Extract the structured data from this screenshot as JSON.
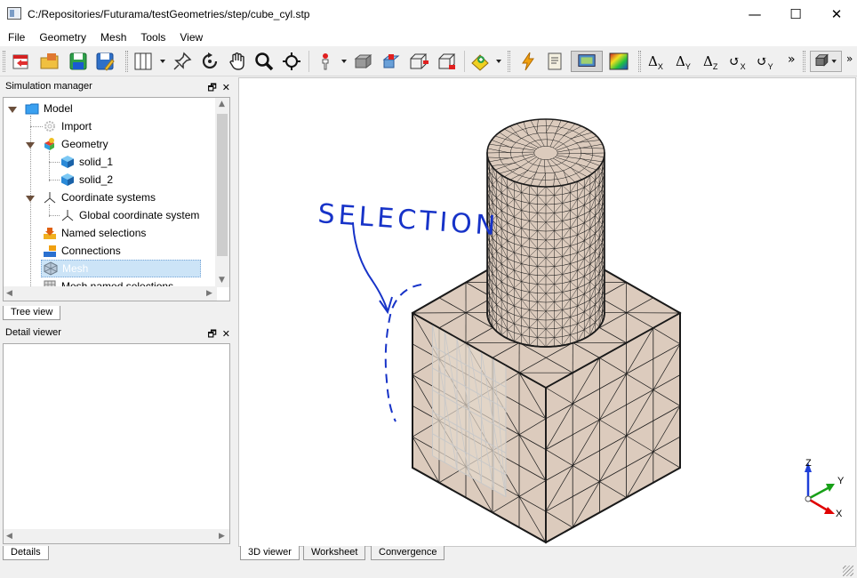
{
  "window": {
    "title": "C:/Repositories/Futurama/testGeometries/step/cube_cyl.stp",
    "minimize_glyph": "—",
    "maximize_glyph": "☐",
    "close_glyph": "✕"
  },
  "menu": [
    "File",
    "Geometry",
    "Mesh",
    "Tools",
    "View"
  ],
  "toolbar": {
    "overflow_glyph": "»",
    "transform_buttons": [
      {
        "symbol": "Δ",
        "axis": "X"
      },
      {
        "symbol": "Δ",
        "axis": "Y"
      },
      {
        "symbol": "Δ",
        "axis": "Z"
      },
      {
        "symbol": "↺",
        "axis": "X"
      },
      {
        "symbol": "↺",
        "axis": "Y"
      }
    ]
  },
  "simulation_manager": {
    "title": "Simulation manager",
    "float_glyph": "🗗",
    "close_glyph": "✕",
    "tree": [
      {
        "label": "Model",
        "icon": "folder-icon"
      },
      {
        "label": "Import",
        "icon": "gear-icon"
      },
      {
        "label": "Geometry",
        "icon": "geometry-icon"
      },
      {
        "label": "solid_1",
        "icon": "cube-icon"
      },
      {
        "label": "solid_2",
        "icon": "cube-icon"
      },
      {
        "label": "Coordinate systems",
        "icon": "axes-icon"
      },
      {
        "label": "Global coordinate system",
        "icon": "axes-icon"
      },
      {
        "label": "Named selections",
        "icon": "named-selection-icon"
      },
      {
        "label": "Connections",
        "icon": "connections-icon"
      },
      {
        "label": "Mesh",
        "icon": "mesh-icon",
        "selected": true
      },
      {
        "label": "Mesh named selections",
        "icon": "mesh-named-selection-icon"
      }
    ],
    "tab": "Tree view"
  },
  "detail_viewer": {
    "title": "Detail viewer",
    "float_glyph": "🗗",
    "close_glyph": "✕",
    "tab": "Details"
  },
  "viewer_tabs": [
    "3D viewer",
    "Worksheet",
    "Convergence"
  ],
  "viewport": {
    "annotation": "SELECTION",
    "axis_labels": {
      "x": "X",
      "y": "Y",
      "z": "Z"
    }
  },
  "colors": {
    "mesh_fill": "#dccbbd",
    "mesh_line": "#1a1a1a",
    "selection_mesh": "#c8c8c8",
    "annotation_ink": "#1733c8",
    "tree_selection": "#cce4f7",
    "axis_x": "#e00000",
    "axis_y": "#18a018",
    "axis_z": "#1f3fd8"
  }
}
